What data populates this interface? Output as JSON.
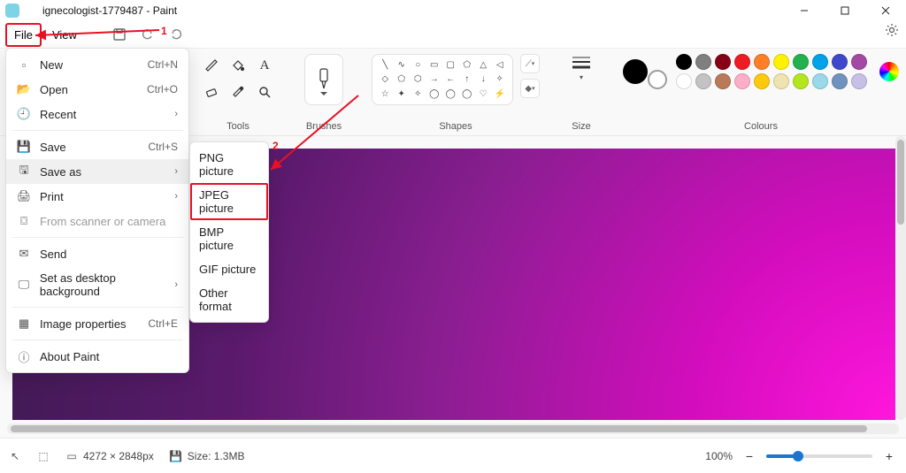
{
  "title": "ignecologist-1779487 - Paint",
  "menubar": {
    "file": "File",
    "view": "View"
  },
  "ribbon": {
    "tools_label": "Tools",
    "brushes_label": "Brushes",
    "shapes_label": "Shapes",
    "size_label": "Size",
    "colours_label": "Colours"
  },
  "palette_row1": [
    "#000000",
    "#7f7f7f",
    "#880015",
    "#ed1c24",
    "#ff7f27",
    "#fff200",
    "#22b14c",
    "#00a2e8",
    "#3f48cc",
    "#a349a4"
  ],
  "palette_row2": [
    "#ffffff",
    "#c3c3c3",
    "#b97a57",
    "#ffaec9",
    "#ffc90e",
    "#efe4b0",
    "#b5e61d",
    "#99d9ea",
    "#7092be",
    "#c8bfe7"
  ],
  "file_menu": {
    "new_lbl": "New",
    "new_sc": "Ctrl+N",
    "open_lbl": "Open",
    "open_sc": "Ctrl+O",
    "recent_lbl": "Recent",
    "save_lbl": "Save",
    "save_sc": "Ctrl+S",
    "saveas_lbl": "Save as",
    "print_lbl": "Print",
    "scanner_lbl": "From scanner or camera",
    "send_lbl": "Send",
    "wallpaper_lbl": "Set as desktop background",
    "props_lbl": "Image properties",
    "props_sc": "Ctrl+E",
    "about_lbl": "About Paint"
  },
  "saveas_menu": {
    "png": "PNG picture",
    "jpeg": "JPEG picture",
    "bmp": "BMP picture",
    "gif": "GIF picture",
    "other": "Other format"
  },
  "annotations": {
    "one": "1",
    "two": "2"
  },
  "status": {
    "dimensions": "4272 × 2848px",
    "filesize": "Size: 1.3MB",
    "zoom": "100%"
  }
}
